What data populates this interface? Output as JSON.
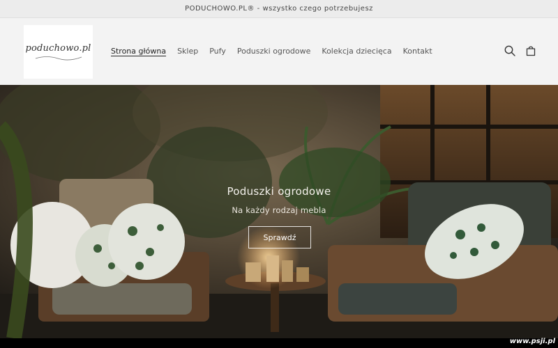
{
  "announcement": {
    "text": "PODUCHOWO.PL® - wszystko czego potrzebujesz"
  },
  "header": {
    "logo_text": "poduchowo.pl",
    "nav": [
      {
        "label": "Strona główna",
        "active": true
      },
      {
        "label": "Sklep"
      },
      {
        "label": "Pufy"
      },
      {
        "label": "Poduszki ogrodowe"
      },
      {
        "label": "Kolekcja dziecięca"
      },
      {
        "label": "Kontakt"
      }
    ],
    "icons": [
      "search-icon",
      "cart-icon"
    ]
  },
  "hero": {
    "title": "Poduszki ogrodowe",
    "subtitle": "Na każdy rodzaj mebla",
    "button_label": "Sprawdź"
  },
  "watermark": "www.psji.pl"
}
